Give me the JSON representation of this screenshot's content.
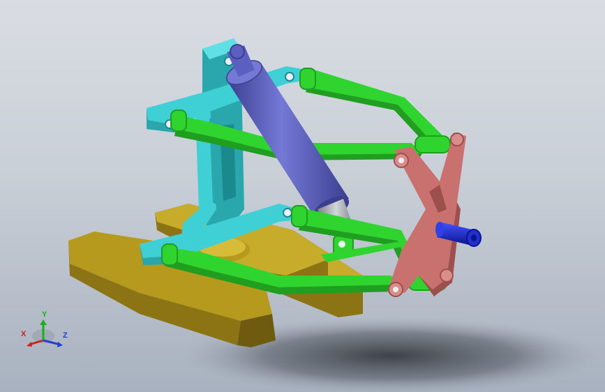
{
  "viewport": {
    "background_top": "#d9dde3",
    "background_bottom": "#a8b1bf"
  },
  "model": {
    "colors": {
      "base": "#b59a1e",
      "base_shade": "#8c7414",
      "bracket": "#3fd0d6",
      "bracket_shade": "#2aa7ad",
      "control_arm": "#2fd42f",
      "control_arm_shade": "#1f9e1f",
      "damper": "#5a5fc0",
      "damper_shade": "#3c3f8f",
      "rod": "#a9adb3",
      "upright": "#c9716f",
      "upright_shade": "#9c4f4d",
      "axle": "#1e2fd6"
    }
  },
  "triad": {
    "x_label": "X",
    "y_label": "Y",
    "z_label": "Z",
    "x_color": "#d02020",
    "y_color": "#18b018",
    "z_color": "#2040d8"
  }
}
